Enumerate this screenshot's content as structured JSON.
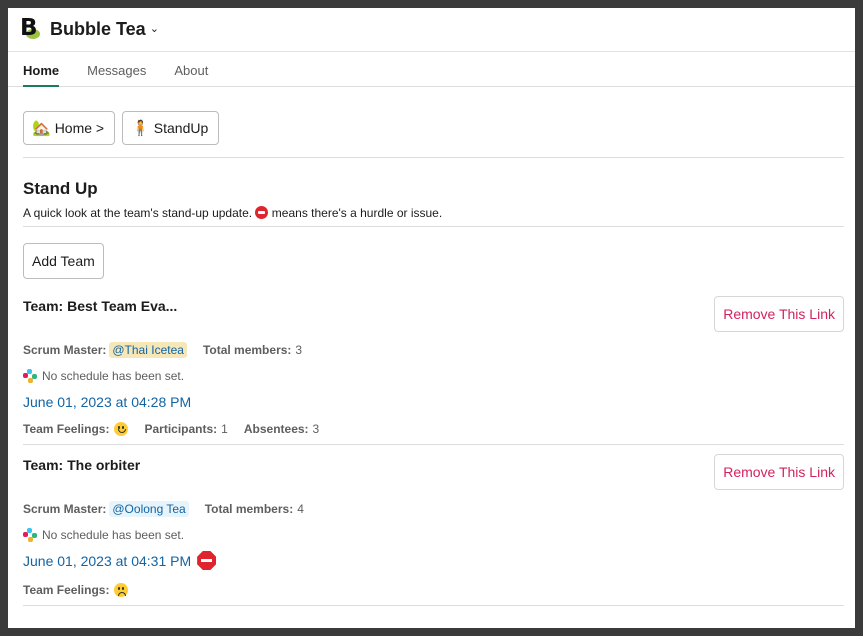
{
  "app": {
    "title": "Bubble Tea",
    "logo_letter": "B"
  },
  "tabs": [
    {
      "label": "Home",
      "active": true
    },
    {
      "label": "Messages",
      "active": false
    },
    {
      "label": "About",
      "active": false
    }
  ],
  "breadcrumb": [
    {
      "label": "Home >",
      "icon": "house-icon"
    },
    {
      "label": "StandUp",
      "icon": "person-standing-icon"
    }
  ],
  "section": {
    "title": "Stand Up",
    "desc_before": "A quick look at the team's stand-up update.",
    "desc_after": "means there's a hurdle or issue."
  },
  "add_team_label": "Add Team",
  "teams": [
    {
      "name": "Team: Best Team Eva...",
      "remove_label": "Remove This Link",
      "scrum_label": "Scrum Master:",
      "scrum_master": "@Thai Icetea",
      "members_label": "Total members:",
      "members": "3",
      "schedule": "No schedule has been set.",
      "date": "June 01, 2023 at 04:28 PM",
      "feelings_label": "Team Feelings:",
      "feeling": "happy-face-icon",
      "participants_label": "Participants:",
      "participants": "1",
      "absentees_label": "Absentees:",
      "absentees": "3"
    },
    {
      "name": "Team: The orbiter",
      "remove_label": "Remove This Link",
      "scrum_label": "Scrum Master:",
      "scrum_master": "@Oolong Tea",
      "members_label": "Total members:",
      "members": "4",
      "schedule": "No schedule has been set.",
      "date": "June 01, 2023 at 04:31 PM",
      "feelings_label": "Team Feelings:",
      "feeling": "worried-face-icon"
    }
  ],
  "colors": {
    "link": "#1264a3",
    "danger": "#d2235e",
    "tab_underline": "#1c7a5f",
    "stop": "#e0242d"
  }
}
